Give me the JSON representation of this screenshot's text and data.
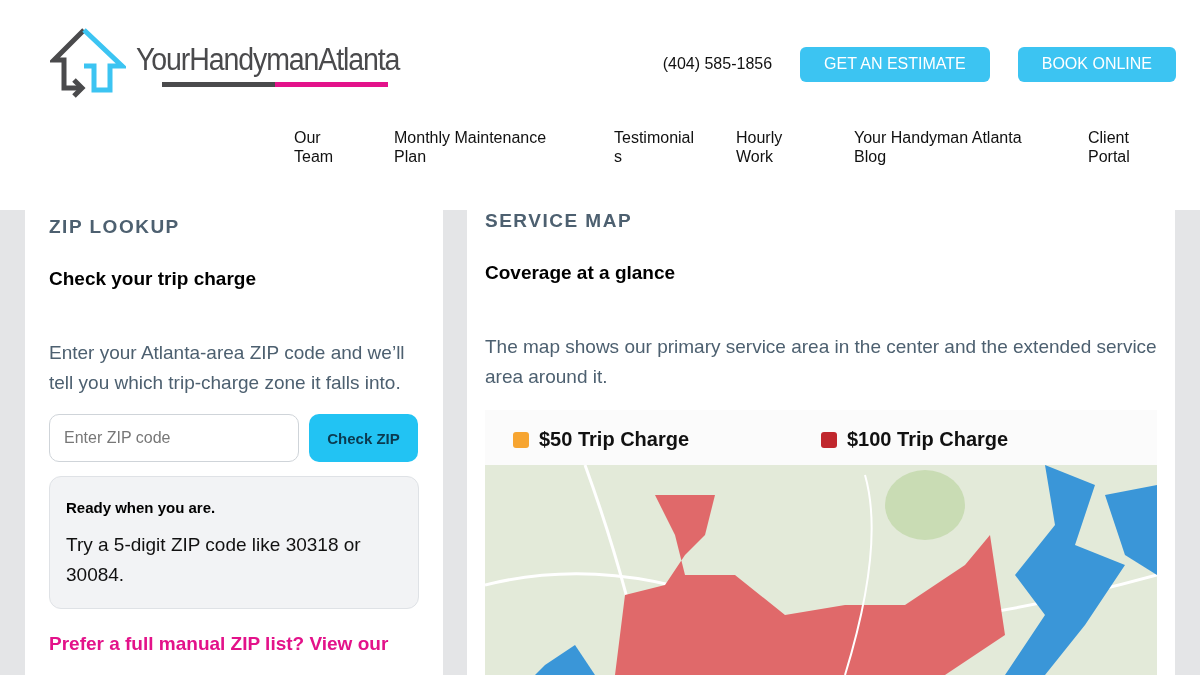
{
  "header": {
    "logo_text": "YourHandymanAtlanta",
    "phone": "(404) 585-1856",
    "buttons": [
      "GET AN ESTIMATE",
      "BOOK ONLINE"
    ],
    "nav": [
      "Our Team",
      "Monthly Maintenance Plan",
      "Testimonials",
      "Hourly Work",
      "Your Handyman Atlanta Blog",
      "Client Portal"
    ]
  },
  "zip_lookup": {
    "eyebrow": "ZIP LOOKUP",
    "title": "Check your trip charge",
    "intro": "Enter your Atlanta-area ZIP code and we’ll tell you which trip-charge zone it falls into.",
    "input": {
      "placeholder": "Enter ZIP code"
    },
    "button": "Check ZIP",
    "result": {
      "title": "Ready when you are.",
      "text": "Try a 5-digit ZIP code like 30318 or 30084."
    },
    "link": "Prefer a full manual ZIP list? View our"
  },
  "service_map": {
    "eyebrow": "SERVICE MAP",
    "title": "Coverage at a glance",
    "intro": "The map shows our primary service area in the center and the extended service area around it.",
    "legend": [
      {
        "label": "$50 Trip Charge",
        "color": "#f7a531"
      },
      {
        "label": "$100 Trip Charge",
        "color": "#c0272d"
      }
    ]
  }
}
